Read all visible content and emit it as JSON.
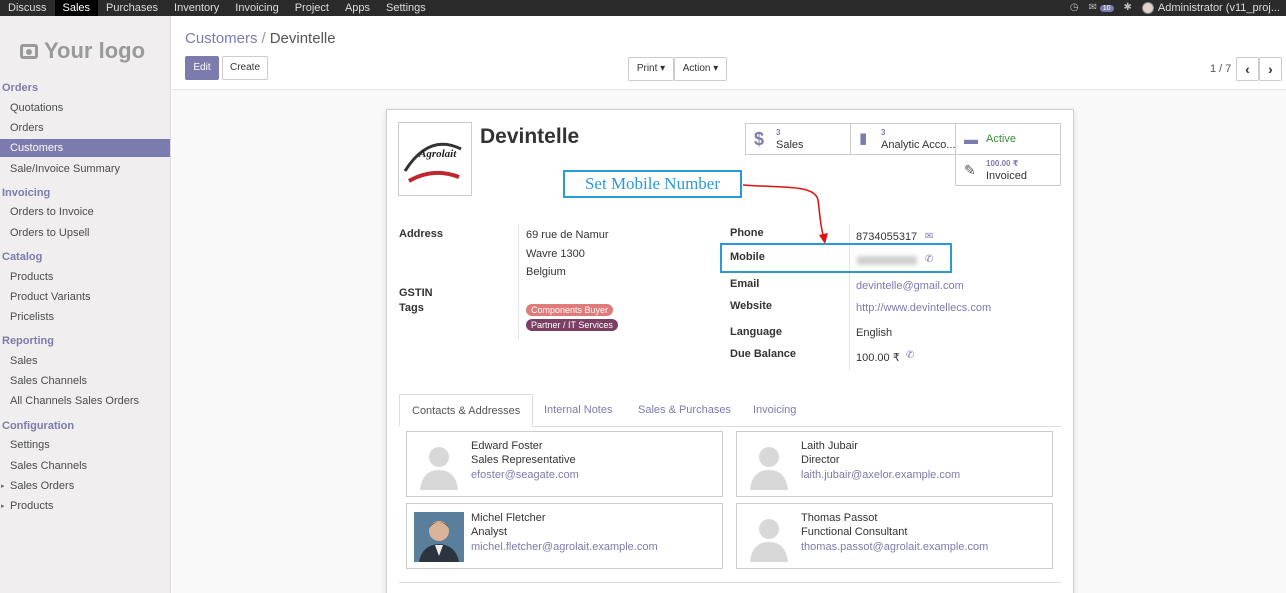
{
  "topmenu": {
    "items": [
      "Discuss",
      "Sales",
      "Purchases",
      "Inventory",
      "Invoicing",
      "Project",
      "Apps",
      "Settings"
    ],
    "active_index": 1,
    "notification_count": "10",
    "user": "Administrator (v11_proj..."
  },
  "sidebar": {
    "logo_text": "Your logo",
    "sections": [
      {
        "title": "Orders",
        "items": [
          "Quotations",
          "Orders",
          "Customers",
          "Sale/Invoice Summary"
        ]
      },
      {
        "title": "Invoicing",
        "items": [
          "Orders to Invoice",
          "Orders to Upsell"
        ]
      },
      {
        "title": "Catalog",
        "items": [
          "Products",
          "Product Variants",
          "Pricelists"
        ]
      },
      {
        "title": "Reporting",
        "items": [
          "Sales",
          "Sales Channels",
          "All Channels Sales Orders"
        ]
      },
      {
        "title": "Configuration",
        "items": [
          "Settings",
          "Sales Channels",
          "Sales Orders",
          "Products"
        ]
      }
    ],
    "active_item": "Customers"
  },
  "breadcrumb": {
    "parent": "Customers",
    "separator": "/",
    "current": "Devintelle"
  },
  "buttons": {
    "edit": "Edit",
    "create": "Create",
    "print": "Print ▾",
    "action": "Action ▾"
  },
  "pager": {
    "text": "1 / 7"
  },
  "record": {
    "name": "Devintelle",
    "logo_text": "Agrolait",
    "smart_buttons": {
      "sales": {
        "count": "3",
        "label": "Sales"
      },
      "analytic": {
        "count": "3",
        "label": "Analytic Acco..."
      },
      "active": {
        "label": "Active"
      },
      "invoiced": {
        "amount": "100.00 ₹",
        "label": "Invoiced"
      }
    },
    "fields": {
      "address_label": "Address",
      "address_line1": "69 rue de Namur",
      "address_line2": "Wavre 1300",
      "address_line3": "Belgium",
      "gstin_label": "GSTIN",
      "tags_label": "Tags",
      "tags": [
        "Components Buyer",
        "Partner / IT Services"
      ],
      "phone_label": "Phone",
      "phone": "8734055317",
      "mobile_label": "Mobile",
      "email_label": "Email",
      "email": "devintelle@gmail.com",
      "website_label": "Website",
      "website": "http://www.devintellecs.com",
      "language_label": "Language",
      "language": "English",
      "due_label": "Due Balance",
      "due": "100.00 ₹"
    },
    "callout": "Set Mobile Number",
    "tabs": [
      "Contacts & Addresses",
      "Internal Notes",
      "Sales & Purchases",
      "Invoicing"
    ],
    "contacts": [
      {
        "name": "Edward Foster",
        "role": "Sales Representative",
        "email": "efoster@seagate.com"
      },
      {
        "name": "Laith Jubair",
        "role": "Director",
        "email": "laith.jubair@axelor.example.com"
      },
      {
        "name": "Michel Fletcher",
        "role": "Analyst",
        "email": "michel.fletcher@agrolait.example.com"
      },
      {
        "name": "Thomas Passot",
        "role": "Functional Consultant",
        "email": "thomas.passot@agrolait.example.com"
      }
    ]
  },
  "colors": {
    "accent": "#7c7bad",
    "callout": "#2a9ad6",
    "tag1": "#e07b7b",
    "tag2": "#7b3f63"
  }
}
